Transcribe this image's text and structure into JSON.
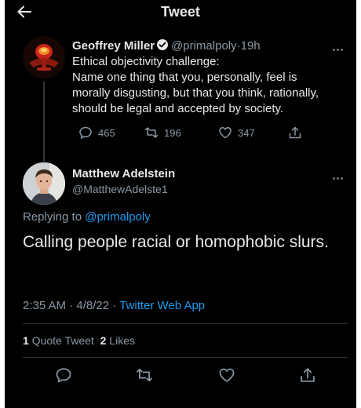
{
  "header": {
    "title": "Tweet",
    "back_icon": "back-arrow-icon"
  },
  "quoted_tweet": {
    "author_name": "Geoffrey Miller",
    "verified": true,
    "handle": "@primalpoly",
    "separator": "·",
    "time": "19h",
    "body_lines": [
      "Ethical objectivity challenge:",
      "Name one thing that you, personally, feel is",
      "morally disgusting, but that you think, rationally,",
      "should be legal and accepted by society."
    ],
    "reply_count": "465",
    "retweet_count": "196",
    "like_count": "347"
  },
  "reply": {
    "author_name": "Matthew Adelstein",
    "handle": "@MatthewAdelste1",
    "replying_to_label": "Replying to",
    "replying_to_handle": "@primalpoly",
    "text": "Calling people racial or homophobic slurs.",
    "time": "2:35 AM",
    "date": "4/8/22",
    "meta_sep": "·",
    "source": "Twitter Web App",
    "quote_count": "1",
    "quote_label": "Quote Tweet",
    "like_count": "2",
    "like_label": "Likes"
  },
  "colors": {
    "background": "#000000",
    "text": "#e7e9ea",
    "muted": "#8b98a5",
    "link": "#1d9bf0",
    "divider": "#2f3336"
  }
}
